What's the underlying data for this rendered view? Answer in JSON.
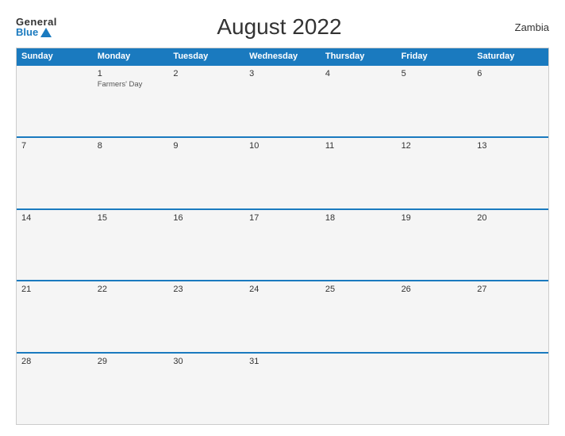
{
  "header": {
    "logo_general": "General",
    "logo_blue": "Blue",
    "title": "August 2022",
    "country": "Zambia"
  },
  "days_of_week": [
    "Sunday",
    "Monday",
    "Tuesday",
    "Wednesday",
    "Thursday",
    "Friday",
    "Saturday"
  ],
  "weeks": [
    [
      {
        "day": "",
        "holiday": ""
      },
      {
        "day": "1",
        "holiday": "Farmers' Day"
      },
      {
        "day": "2",
        "holiday": ""
      },
      {
        "day": "3",
        "holiday": ""
      },
      {
        "day": "4",
        "holiday": ""
      },
      {
        "day": "5",
        "holiday": ""
      },
      {
        "day": "6",
        "holiday": ""
      }
    ],
    [
      {
        "day": "7",
        "holiday": ""
      },
      {
        "day": "8",
        "holiday": ""
      },
      {
        "day": "9",
        "holiday": ""
      },
      {
        "day": "10",
        "holiday": ""
      },
      {
        "day": "11",
        "holiday": ""
      },
      {
        "day": "12",
        "holiday": ""
      },
      {
        "day": "13",
        "holiday": ""
      }
    ],
    [
      {
        "day": "14",
        "holiday": ""
      },
      {
        "day": "15",
        "holiday": ""
      },
      {
        "day": "16",
        "holiday": ""
      },
      {
        "day": "17",
        "holiday": ""
      },
      {
        "day": "18",
        "holiday": ""
      },
      {
        "day": "19",
        "holiday": ""
      },
      {
        "day": "20",
        "holiday": ""
      }
    ],
    [
      {
        "day": "21",
        "holiday": ""
      },
      {
        "day": "22",
        "holiday": ""
      },
      {
        "day": "23",
        "holiday": ""
      },
      {
        "day": "24",
        "holiday": ""
      },
      {
        "day": "25",
        "holiday": ""
      },
      {
        "day": "26",
        "holiday": ""
      },
      {
        "day": "27",
        "holiday": ""
      }
    ],
    [
      {
        "day": "28",
        "holiday": ""
      },
      {
        "day": "29",
        "holiday": ""
      },
      {
        "day": "30",
        "holiday": ""
      },
      {
        "day": "31",
        "holiday": ""
      },
      {
        "day": "",
        "holiday": ""
      },
      {
        "day": "",
        "holiday": ""
      },
      {
        "day": "",
        "holiday": ""
      }
    ]
  ]
}
